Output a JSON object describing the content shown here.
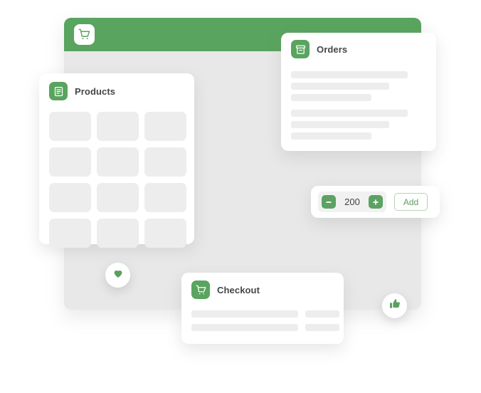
{
  "app": {
    "header_icon": "shopping-cart-icon",
    "accent_color": "#59a45e",
    "placeholder_color": "#ededed",
    "backdrop_color": "#e8e8e8"
  },
  "products_card": {
    "title": "Products",
    "icon": "document-list-icon",
    "tiles": [
      1,
      2,
      3,
      4,
      5,
      6,
      7,
      8,
      9,
      10,
      11,
      12
    ]
  },
  "orders_card": {
    "title": "Orders",
    "icon": "archive-box-icon",
    "bar_groups": [
      [
        100,
        84,
        57
      ],
      [
        100,
        84,
        57
      ]
    ]
  },
  "checkout_card": {
    "title": "Checkout",
    "icon": "shopping-cart-icon",
    "rows": [
      {
        "wide": 150,
        "narrow": 48
      },
      {
        "wide": 150,
        "narrow": 48
      }
    ]
  },
  "quantity_card": {
    "decrement_label": "minus-icon",
    "increment_label": "plus-icon",
    "value": "200",
    "add_label": "Add"
  },
  "badges": [
    {
      "name": "heart-badge",
      "icon": "heart-icon"
    },
    {
      "name": "thumbs-up-badge",
      "icon": "thumbs-up-icon"
    }
  ]
}
